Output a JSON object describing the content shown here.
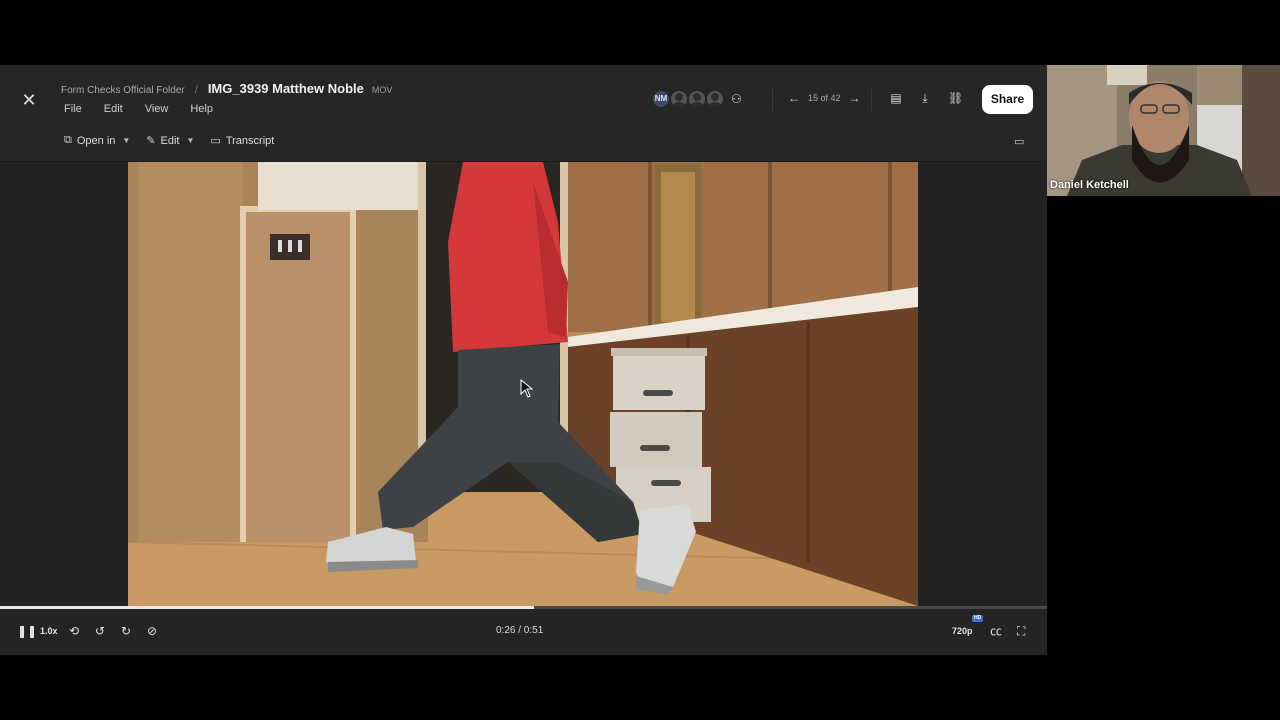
{
  "header": {
    "folder": "Form Checks Official Folder",
    "separator": "/",
    "title": "IMG_3939 Matthew Noble",
    "file_ext": "MOV"
  },
  "menu": [
    "File",
    "Edit",
    "View",
    "Help"
  ],
  "toolbar": {
    "open_in": "Open in",
    "edit": "Edit",
    "transcript": "Transcript"
  },
  "collaborators": {
    "initials": "NM"
  },
  "pager": {
    "count": "15 of 42"
  },
  "share": {
    "label": "Share"
  },
  "player": {
    "speed": "1.0x",
    "time": "0:26 / 0:51",
    "progress": 0.51,
    "quality": "720p",
    "hd": "HD"
  },
  "webcam": {
    "name": "Daniel Ketchell"
  }
}
